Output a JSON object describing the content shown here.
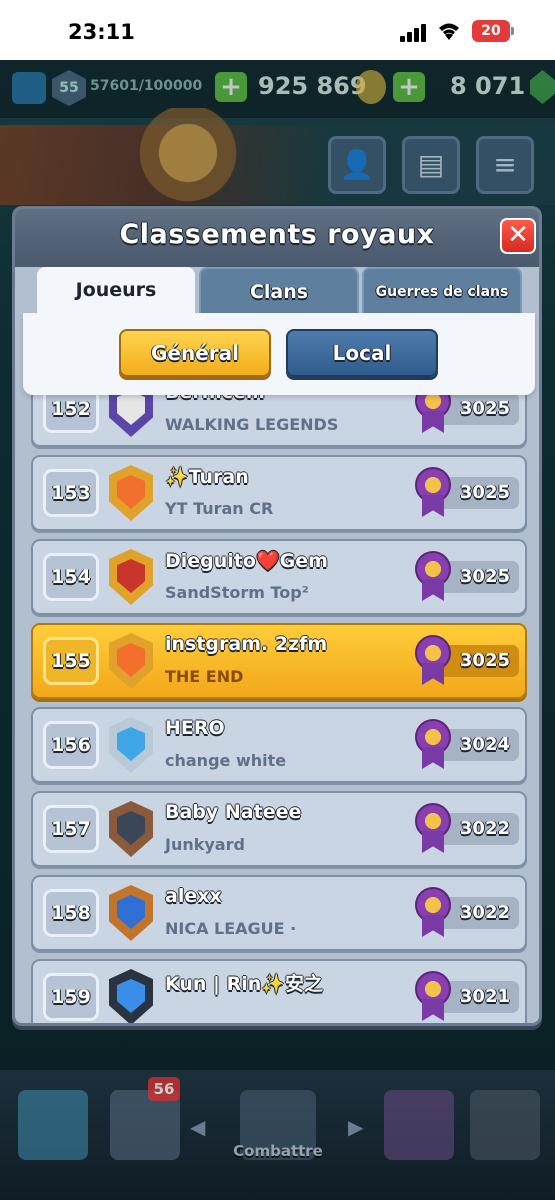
{
  "status_bar": {
    "time": "23:11",
    "battery": "20"
  },
  "resources": {
    "level": "55",
    "xp": "57601/100000",
    "gold": "925 869",
    "gems": "8 071"
  },
  "modal": {
    "title": "Classements royaux",
    "close_label": "✕",
    "tabs": [
      {
        "label": "Joueurs",
        "active": true
      },
      {
        "label": "Clans",
        "active": false
      },
      {
        "label": "Guerres de clans",
        "active": false
      }
    ],
    "subtabs": {
      "general": "Général",
      "local": "Local"
    }
  },
  "leaderboard": [
    {
      "rank": "152",
      "name": "Bernice…",
      "clan": "WALKING LEGENDS",
      "trophies": "3025",
      "badge_color": "#5b46a8",
      "badge_inner": "#e6e6e6"
    },
    {
      "rank": "153",
      "name": "✨Turan",
      "clan": "YT Turan CR",
      "trophies": "3025",
      "badge_color": "#e0a22b",
      "badge_inner": "#f36f2e"
    },
    {
      "rank": "154",
      "name": "Dieguito❤️Gem",
      "clan": "SandStorm Top²",
      "trophies": "3025",
      "badge_color": "#e0a22b",
      "badge_inner": "#c9352b"
    },
    {
      "rank": "155",
      "name": "instgram. 2zfm",
      "clan": "THE END",
      "trophies": "3025",
      "badge_color": "#e0a22b",
      "badge_inner": "#f36f2e",
      "highlight": true
    },
    {
      "rank": "156",
      "name": "HERO",
      "clan": "change white",
      "trophies": "3024",
      "badge_color": "#b9c9d8",
      "badge_inner": "#3fa6e8"
    },
    {
      "rank": "157",
      "name": "Baby Nateee",
      "clan": "Junkyard",
      "trophies": "3022",
      "badge_color": "#8a5a3a",
      "badge_inner": "#3b4758"
    },
    {
      "rank": "158",
      "name": "alexx",
      "clan": "NICA LEAGUE ·",
      "trophies": "3022",
      "badge_color": "#c2752a",
      "badge_inner": "#2f6fd6"
    },
    {
      "rank": "159",
      "name": "Kun | Rin✨安之",
      "clan": "",
      "trophies": "3021",
      "badge_color": "#2a3440",
      "badge_inner": "#3b8ee8"
    }
  ],
  "bottom_nav": {
    "battle_label": "Combattre",
    "cards_badge": "56"
  }
}
